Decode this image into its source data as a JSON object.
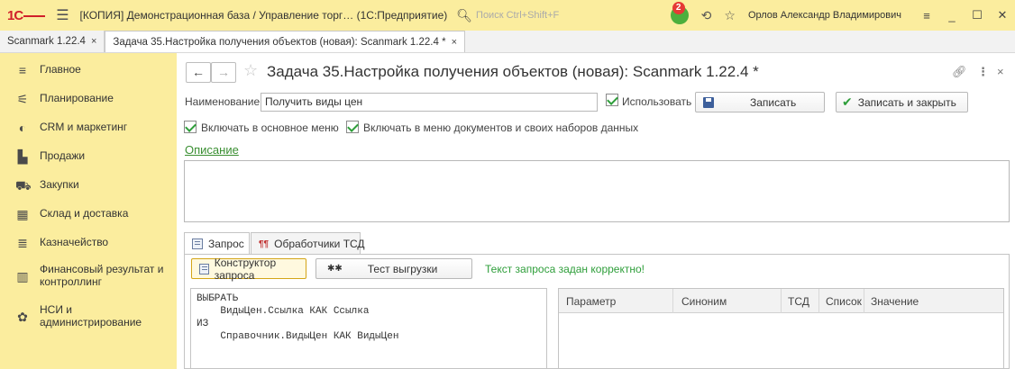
{
  "titlebar": {
    "logo": "1С",
    "title": "[КОПИЯ] Демонстрационная база / Управление торг…  (1С:Предприятие)",
    "search_placeholder": "Поиск Ctrl+Shift+F",
    "notif_count": "2",
    "user": "Орлов Александр Владимирович"
  },
  "tabs": [
    {
      "label": "Scanmark 1.22.4",
      "close": "×"
    },
    {
      "label": "Задача 35.Настройка получения объектов (новая): Scanmark 1.22.4 *",
      "close": "×"
    }
  ],
  "sidebar": {
    "items": [
      {
        "label": "Главное",
        "icon": "menu-icon"
      },
      {
        "label": "Планирование",
        "icon": "planning-icon"
      },
      {
        "label": "CRM и маркетинг",
        "icon": "crm-icon"
      },
      {
        "label": "Продажи",
        "icon": "sales-icon"
      },
      {
        "label": "Закупки",
        "icon": "cart-icon"
      },
      {
        "label": "Склад и доставка",
        "icon": "warehouse-icon"
      },
      {
        "label": "Казначейство",
        "icon": "treasury-icon"
      },
      {
        "label": "Финансовый результат и контроллинг",
        "icon": "chart-icon"
      },
      {
        "label": "НСИ и администрирование",
        "icon": "gear-icon"
      }
    ]
  },
  "form": {
    "title": "Задача 35.Настройка получения объектов (новая): Scanmark 1.22.4 *",
    "name_label": "Наименование:",
    "name_value": "Получить виды цен",
    "use_label": "Использовать",
    "save_label": "Записать",
    "save_close_label": "Записать и закрыть",
    "main_menu_label": "Включать в основное меню",
    "doc_menu_label": "Включать в меню документов и своих наборов данных",
    "description_link": "Описание"
  },
  "panel_tabs": [
    {
      "label": "Запрос"
    },
    {
      "label": "Обработчики ТСД"
    }
  ],
  "query": {
    "builder_label": "Конструктор запроса",
    "test_label": "Тест выгрузки",
    "status": "Текст запроса задан корректно!",
    "text": "ВЫБРАТЬ\n    ВидыЦен.Ссылка КАК Ссылка\nИЗ\n    Справочник.ВидыЦен КАК ВидыЦен"
  },
  "params_table": {
    "columns": [
      "Параметр",
      "Синоним",
      "ТСД",
      "Список",
      "Значение"
    ]
  },
  "colors": {
    "sidebar_bg": "#fbed9e",
    "accent_green": "#2e9e3a",
    "logo_red": "#d0202a"
  }
}
